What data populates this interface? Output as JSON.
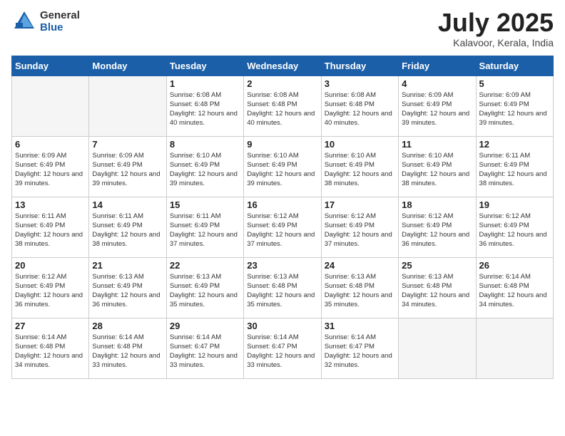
{
  "logo": {
    "general": "General",
    "blue": "Blue"
  },
  "title": "July 2025",
  "subtitle": "Kalavoor, Kerala, India",
  "headers": [
    "Sunday",
    "Monday",
    "Tuesday",
    "Wednesday",
    "Thursday",
    "Friday",
    "Saturday"
  ],
  "weeks": [
    [
      {
        "day": "",
        "detail": ""
      },
      {
        "day": "",
        "detail": ""
      },
      {
        "day": "1",
        "detail": "Sunrise: 6:08 AM\nSunset: 6:48 PM\nDaylight: 12 hours and 40 minutes."
      },
      {
        "day": "2",
        "detail": "Sunrise: 6:08 AM\nSunset: 6:48 PM\nDaylight: 12 hours and 40 minutes."
      },
      {
        "day": "3",
        "detail": "Sunrise: 6:08 AM\nSunset: 6:48 PM\nDaylight: 12 hours and 40 minutes."
      },
      {
        "day": "4",
        "detail": "Sunrise: 6:09 AM\nSunset: 6:49 PM\nDaylight: 12 hours and 39 minutes."
      },
      {
        "day": "5",
        "detail": "Sunrise: 6:09 AM\nSunset: 6:49 PM\nDaylight: 12 hours and 39 minutes."
      }
    ],
    [
      {
        "day": "6",
        "detail": "Sunrise: 6:09 AM\nSunset: 6:49 PM\nDaylight: 12 hours and 39 minutes."
      },
      {
        "day": "7",
        "detail": "Sunrise: 6:09 AM\nSunset: 6:49 PM\nDaylight: 12 hours and 39 minutes."
      },
      {
        "day": "8",
        "detail": "Sunrise: 6:10 AM\nSunset: 6:49 PM\nDaylight: 12 hours and 39 minutes."
      },
      {
        "day": "9",
        "detail": "Sunrise: 6:10 AM\nSunset: 6:49 PM\nDaylight: 12 hours and 39 minutes."
      },
      {
        "day": "10",
        "detail": "Sunrise: 6:10 AM\nSunset: 6:49 PM\nDaylight: 12 hours and 38 minutes."
      },
      {
        "day": "11",
        "detail": "Sunrise: 6:10 AM\nSunset: 6:49 PM\nDaylight: 12 hours and 38 minutes."
      },
      {
        "day": "12",
        "detail": "Sunrise: 6:11 AM\nSunset: 6:49 PM\nDaylight: 12 hours and 38 minutes."
      }
    ],
    [
      {
        "day": "13",
        "detail": "Sunrise: 6:11 AM\nSunset: 6:49 PM\nDaylight: 12 hours and 38 minutes."
      },
      {
        "day": "14",
        "detail": "Sunrise: 6:11 AM\nSunset: 6:49 PM\nDaylight: 12 hours and 38 minutes."
      },
      {
        "day": "15",
        "detail": "Sunrise: 6:11 AM\nSunset: 6:49 PM\nDaylight: 12 hours and 37 minutes."
      },
      {
        "day": "16",
        "detail": "Sunrise: 6:12 AM\nSunset: 6:49 PM\nDaylight: 12 hours and 37 minutes."
      },
      {
        "day": "17",
        "detail": "Sunrise: 6:12 AM\nSunset: 6:49 PM\nDaylight: 12 hours and 37 minutes."
      },
      {
        "day": "18",
        "detail": "Sunrise: 6:12 AM\nSunset: 6:49 PM\nDaylight: 12 hours and 36 minutes."
      },
      {
        "day": "19",
        "detail": "Sunrise: 6:12 AM\nSunset: 6:49 PM\nDaylight: 12 hours and 36 minutes."
      }
    ],
    [
      {
        "day": "20",
        "detail": "Sunrise: 6:12 AM\nSunset: 6:49 PM\nDaylight: 12 hours and 36 minutes."
      },
      {
        "day": "21",
        "detail": "Sunrise: 6:13 AM\nSunset: 6:49 PM\nDaylight: 12 hours and 36 minutes."
      },
      {
        "day": "22",
        "detail": "Sunrise: 6:13 AM\nSunset: 6:49 PM\nDaylight: 12 hours and 35 minutes."
      },
      {
        "day": "23",
        "detail": "Sunrise: 6:13 AM\nSunset: 6:48 PM\nDaylight: 12 hours and 35 minutes."
      },
      {
        "day": "24",
        "detail": "Sunrise: 6:13 AM\nSunset: 6:48 PM\nDaylight: 12 hours and 35 minutes."
      },
      {
        "day": "25",
        "detail": "Sunrise: 6:13 AM\nSunset: 6:48 PM\nDaylight: 12 hours and 34 minutes."
      },
      {
        "day": "26",
        "detail": "Sunrise: 6:14 AM\nSunset: 6:48 PM\nDaylight: 12 hours and 34 minutes."
      }
    ],
    [
      {
        "day": "27",
        "detail": "Sunrise: 6:14 AM\nSunset: 6:48 PM\nDaylight: 12 hours and 34 minutes."
      },
      {
        "day": "28",
        "detail": "Sunrise: 6:14 AM\nSunset: 6:48 PM\nDaylight: 12 hours and 33 minutes."
      },
      {
        "day": "29",
        "detail": "Sunrise: 6:14 AM\nSunset: 6:47 PM\nDaylight: 12 hours and 33 minutes."
      },
      {
        "day": "30",
        "detail": "Sunrise: 6:14 AM\nSunset: 6:47 PM\nDaylight: 12 hours and 33 minutes."
      },
      {
        "day": "31",
        "detail": "Sunrise: 6:14 AM\nSunset: 6:47 PM\nDaylight: 12 hours and 32 minutes."
      },
      {
        "day": "",
        "detail": ""
      },
      {
        "day": "",
        "detail": ""
      }
    ]
  ]
}
